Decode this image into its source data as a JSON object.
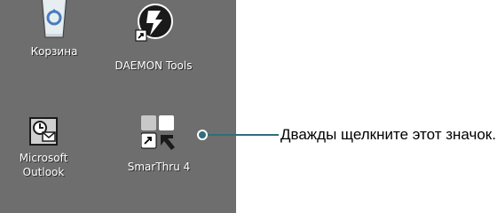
{
  "desktop": {
    "icons": [
      {
        "label": "Корзина",
        "icon": "recycle-bin-icon"
      },
      {
        "label": "DAEMON Tools",
        "icon": "daemon-tools-icon"
      },
      {
        "label": "Microsoft\nOutlook",
        "icon": "outlook-icon"
      },
      {
        "label": "SmarThru 4",
        "icon": "smarthru-icon"
      }
    ]
  },
  "callout": {
    "text": "Дважды щелкните этот значок."
  },
  "colors": {
    "desktop_bg": "#6e6e6e",
    "callout": "#2f6f7a",
    "icon_label": "#ffffff"
  }
}
